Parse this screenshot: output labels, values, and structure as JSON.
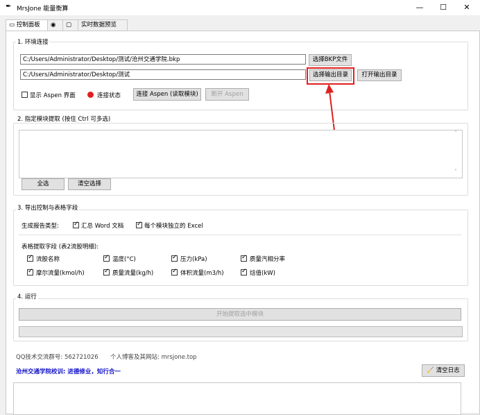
{
  "window": {
    "title": "MrsJone 能量衡算",
    "minimize": "—",
    "maximize": "☐",
    "close": "✕"
  },
  "tabs": [
    {
      "label": "控制面板"
    },
    {
      "label": ""
    },
    {
      "label": ""
    },
    {
      "label": "实时数据预览"
    }
  ],
  "env": {
    "section_title": "1. 环境连接",
    "bkp_path": "C:/Users/Administrator/Desktop/测试/沧州交通学院.bkp",
    "select_bkp": "选择BKP文件",
    "output_path": "C:/Users/Administrator/Desktop/测试",
    "select_output": "选择输出目录",
    "open_output": "打开输出目录",
    "show_aspen": "显示 Aspen 界面",
    "status": "连接状态",
    "status_color": "#e02020",
    "connect": "连接 Aspen (读取模块)",
    "disconnect": "断开 Aspen"
  },
  "modules": {
    "section_title": "2. 指定模块提取 (按住 Ctrl 可多选)",
    "select_all": "全选",
    "clear_select": "清空选择"
  },
  "export": {
    "section_title": "3. 导出控制与表格字段",
    "report_type_label": "生成报告类型:",
    "report_word": "汇总 Word 文档",
    "report_excel": "每个模块独立的 Excel",
    "fields_label": "表格提取字段 (表2流股明细):",
    "fields": [
      "流股名称",
      "温度(°C)",
      "压力(kPa)",
      "质量汽相分率",
      "摩尔流量(kmol/h)",
      "质量流量(kg/h)",
      "体积流量(m3/h)",
      "焓值(kW)"
    ]
  },
  "run": {
    "section_title": "4. 运行",
    "start": "开始提取选中模块",
    "progress": 0
  },
  "footer": {
    "qq": "QQ技术交流群号: 562721026",
    "site": "个人博客及其网站: mrsjone.top",
    "motto": "沧州交通学院校训: 进德修业，知行合一",
    "clear_log": "清空日志"
  }
}
